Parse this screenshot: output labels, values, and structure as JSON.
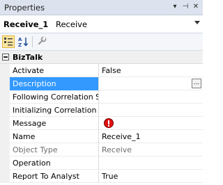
{
  "panel": {
    "title": "Properties",
    "controls": {
      "dropdown": "▾",
      "pin": "⊣",
      "close": "✕"
    }
  },
  "selector": {
    "object_name": "Receive_1",
    "object_type": "Receive"
  },
  "toolbar": {
    "buttons": [
      {
        "name": "categorized-button",
        "icon": "categorized-icon",
        "active": true
      },
      {
        "name": "alphabetical-button",
        "icon": "alphabetical-icon",
        "active": false
      },
      {
        "name": "property-pages-button",
        "icon": "wrench-icon",
        "active": false
      }
    ]
  },
  "grid": {
    "category": "BizTalk",
    "rows": [
      {
        "name": "Activate",
        "value": "False"
      },
      {
        "name": "Description",
        "value": "",
        "selected": true,
        "has_ellipsis": true,
        "ellipsis_label": "..."
      },
      {
        "name": "Following Correlation S",
        "value": ""
      },
      {
        "name": "Initializing Correlation S",
        "value": ""
      },
      {
        "name": "Message",
        "value": "",
        "error_icon": true
      },
      {
        "name": "Name",
        "value": "Receive_1"
      },
      {
        "name": "Object Type",
        "value": "Receive",
        "readonly": true
      },
      {
        "name": "Operation",
        "value": ""
      },
      {
        "name": "Report To Analyst",
        "value": "True"
      }
    ]
  },
  "colors": {
    "selection": "#3399ff",
    "titlebar": "#dde3ee",
    "category_background": "#f0f0f0",
    "error": "#dd1111"
  }
}
